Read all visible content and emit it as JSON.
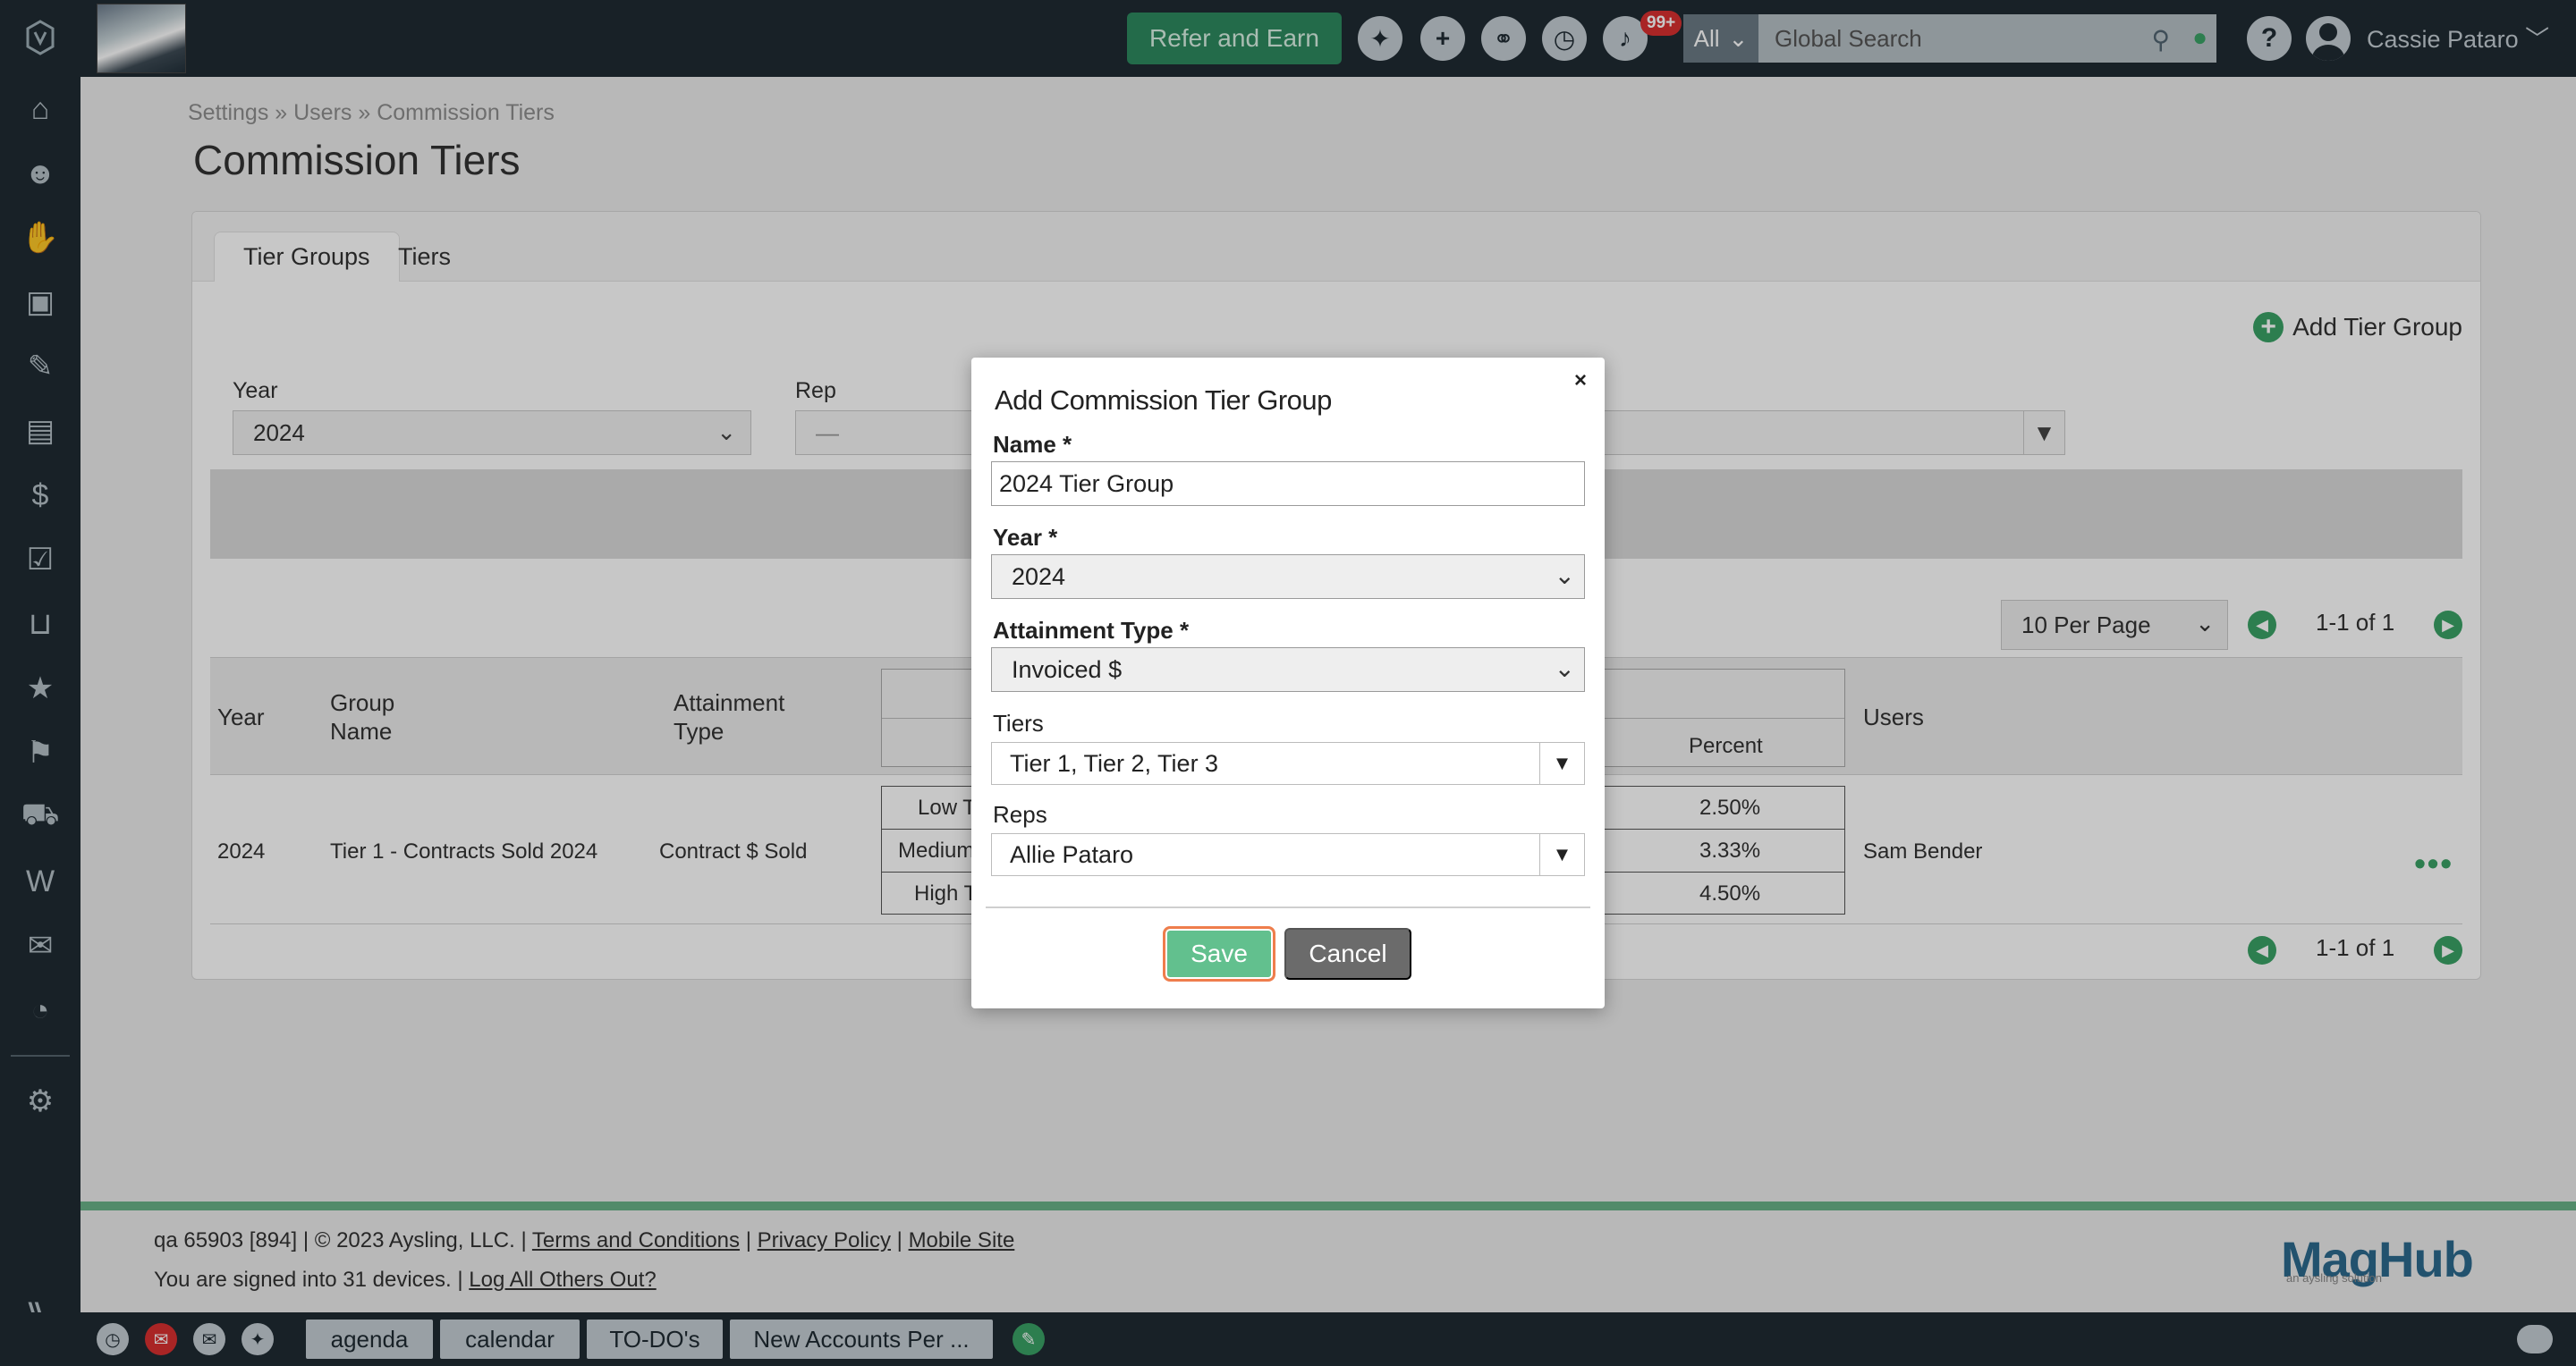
{
  "topbar": {
    "refer_label": "Refer and Earn",
    "notification_count": "99+",
    "search_scope": "All",
    "search_placeholder": "Global Search",
    "user_name": "Cassie Pataro"
  },
  "breadcrumb": "Settings » Users » Commission Tiers",
  "page_title": "Commission Tiers",
  "tabs": [
    {
      "label": "Tier Groups",
      "active": true
    },
    {
      "label": "Tiers",
      "active": false
    }
  ],
  "add_tier_group_label": "Add Tier Group",
  "filters": {
    "year_label": "Year",
    "year_value": "2024",
    "rep_label": "Rep",
    "rep_value": "—"
  },
  "pagination": {
    "per_page": "10 Per Page",
    "range_text": "1-1 of 1"
  },
  "table": {
    "headers": {
      "year": "Year",
      "group_name": "Group Name",
      "attainment_type": "Attainment Type",
      "percent": "Percent",
      "users": "Users"
    },
    "rows": [
      {
        "year": "2024",
        "group_name": "Tier 1 - Contracts Sold 2024",
        "attainment_type": "Contract $ Sold",
        "tiers": [
          {
            "label": "Low T",
            "percent": "2.50%"
          },
          {
            "label": "Medium",
            "percent": "3.33%"
          },
          {
            "label": "High T",
            "percent": "4.50%"
          }
        ],
        "users": "Sam Bender"
      }
    ]
  },
  "modal": {
    "title": "Add Commission Tier Group",
    "close_label": "×",
    "name_label": "Name *",
    "name_value": "2024 Tier Group",
    "year_label": "Year *",
    "year_value": "2024",
    "attainment_label": "Attainment Type *",
    "attainment_value": "Invoiced $",
    "tiers_label": "Tiers",
    "tiers_value": "Tier 1, Tier 2, Tier 3",
    "reps_label": "Reps",
    "reps_value": "Allie Pataro",
    "save_label": "Save",
    "cancel_label": "Cancel"
  },
  "footer": {
    "line1_prefix": "qa 65903 [894] | © 2023 Aysling, LLC. |",
    "terms": "Terms and Conditions",
    "privacy": "Privacy Policy",
    "mobile": "Mobile Site",
    "line2_prefix": "You are signed into 31 devices. |",
    "logout_others": "Log All Others Out?",
    "logo_text": "MagHub",
    "logo_sub": "an aysling solution"
  },
  "bottombar": {
    "buttons": [
      "agenda",
      "calendar",
      "TO-DO's",
      "New Accounts Per ..."
    ]
  },
  "colors": {
    "nav_bg": "#1f2b33",
    "accent_green": "#3aa266",
    "save_green": "#62c08e",
    "focus_orange": "#ef7d4c"
  }
}
